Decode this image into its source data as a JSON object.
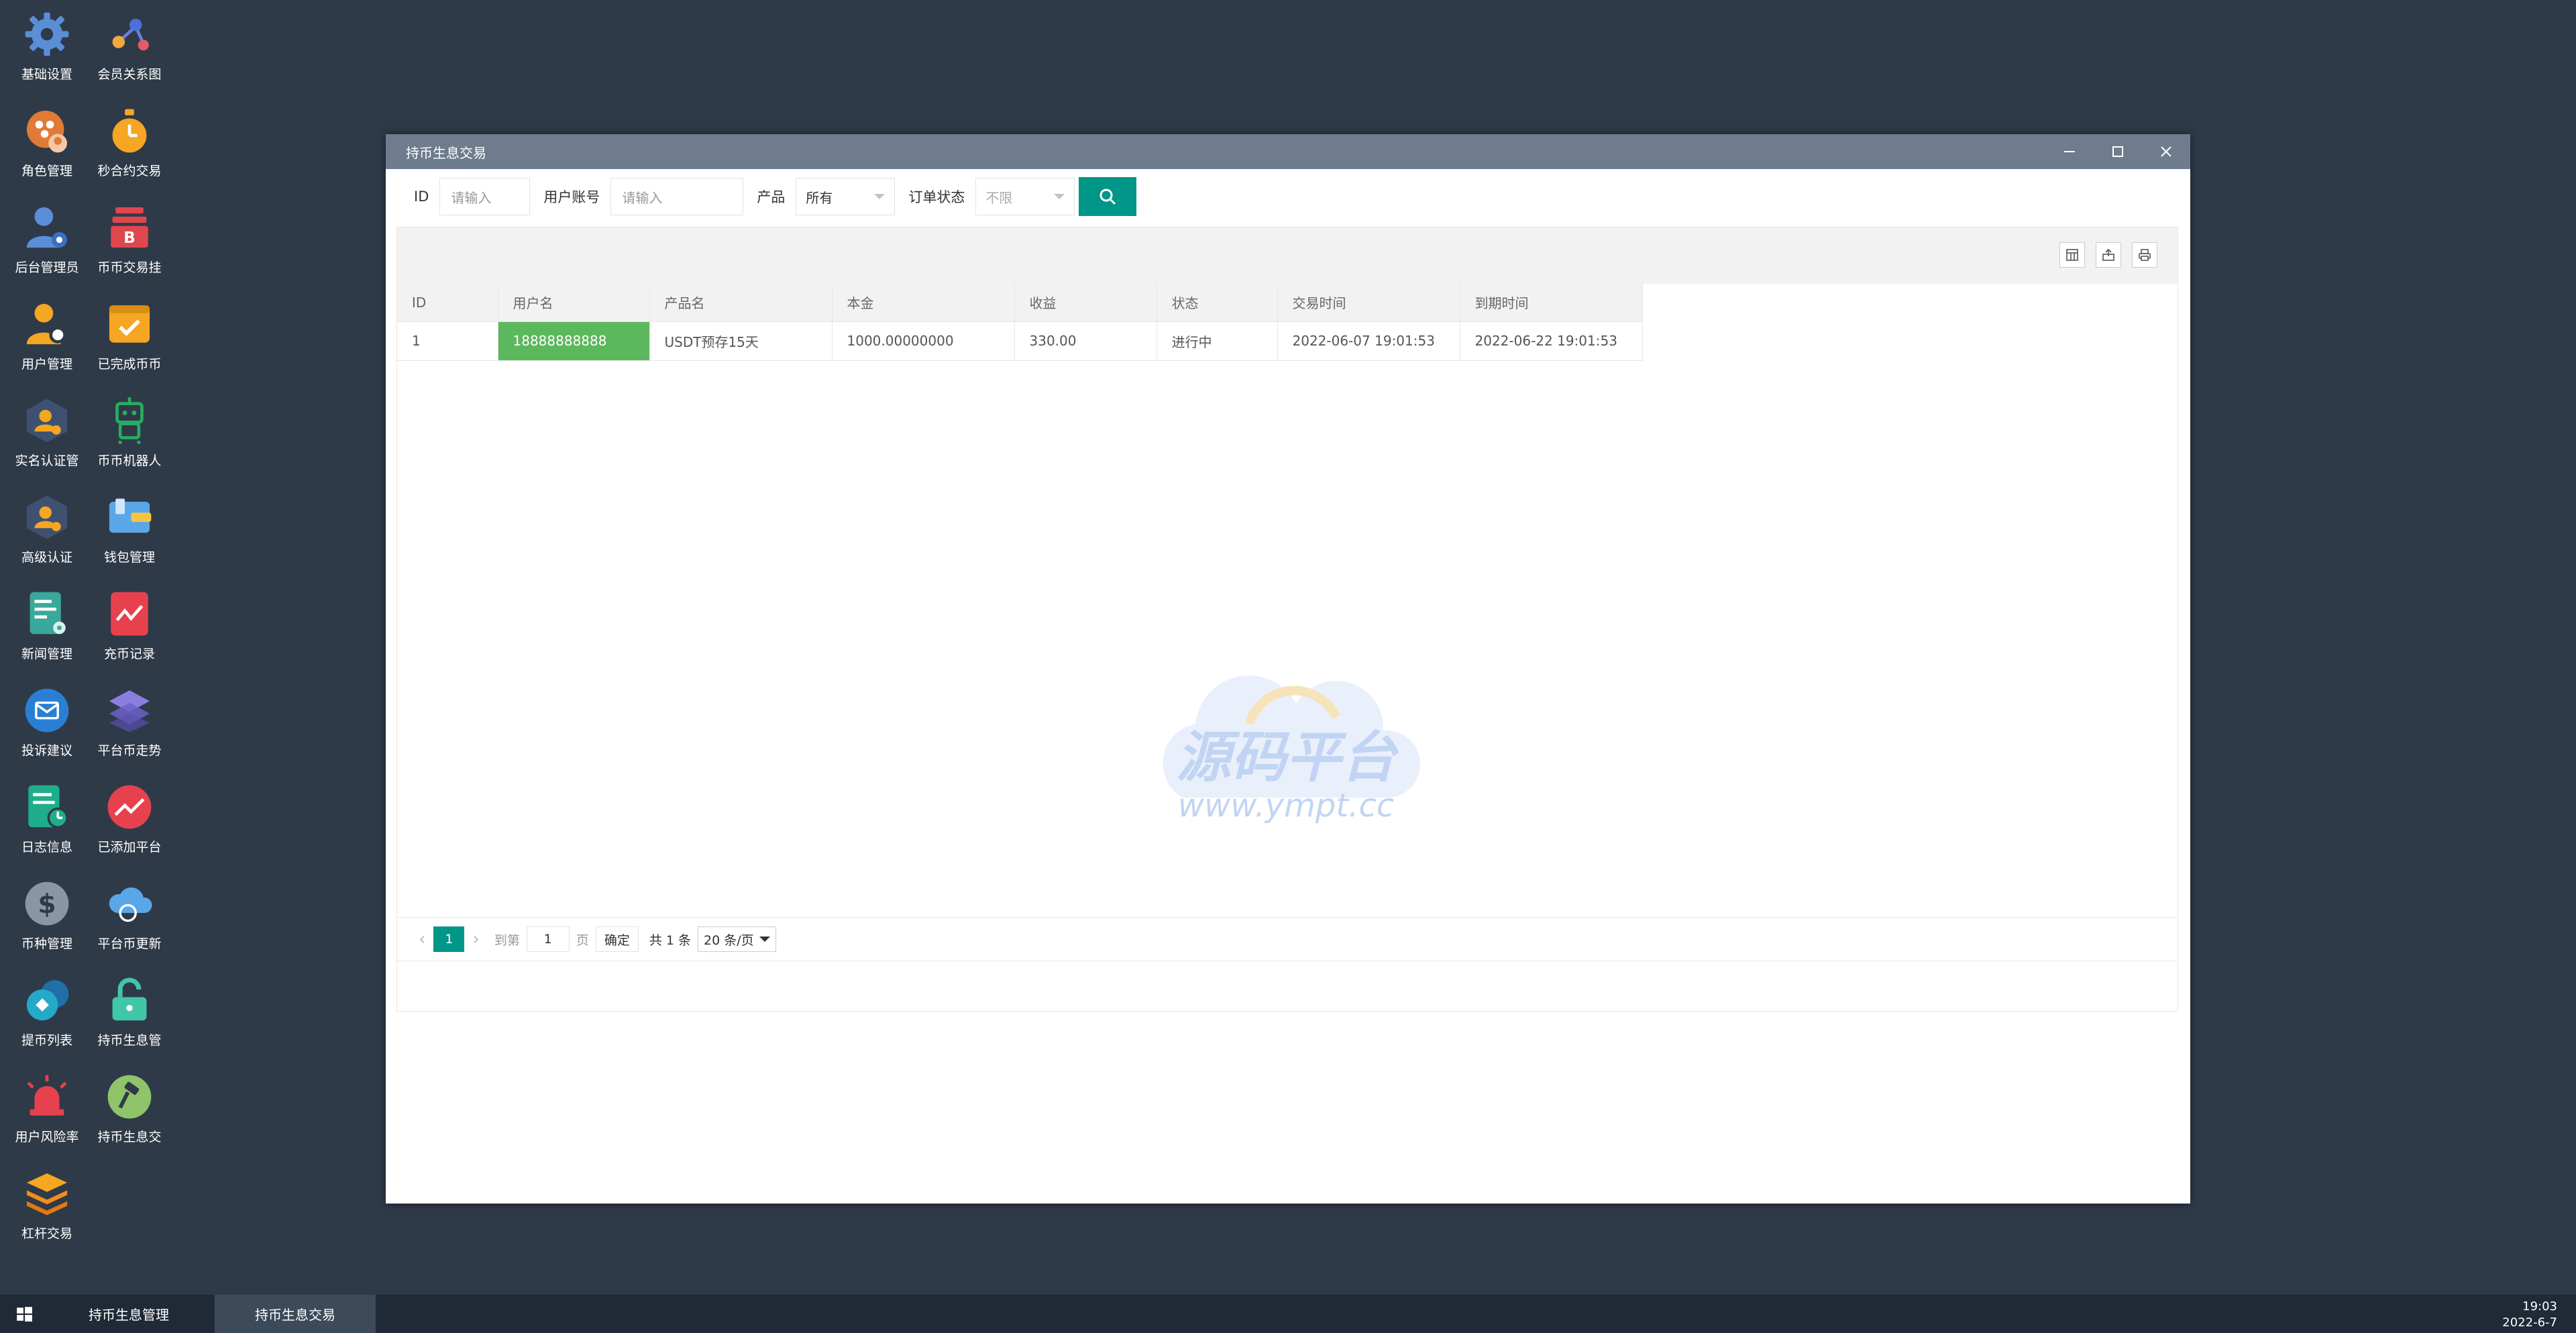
{
  "desktop": {
    "icons": [
      {
        "label": "基础设置",
        "icon": "gear-icon"
      },
      {
        "label": "会员关系图",
        "icon": "network-icon"
      },
      {
        "label": "角色管理",
        "icon": "role-icon"
      },
      {
        "label": "秒合约交易",
        "icon": "stopwatch-icon"
      },
      {
        "label": "后台管理员",
        "icon": "admin-user-icon"
      },
      {
        "label": "币币交易挂",
        "icon": "bitcoin-stack-icon"
      },
      {
        "label": "用户管理",
        "icon": "user-search-icon"
      },
      {
        "label": "已完成币币",
        "icon": "check-box-icon"
      },
      {
        "label": "实名认证管",
        "icon": "verified-user-icon"
      },
      {
        "label": "币币机器人",
        "icon": "robot-icon"
      },
      {
        "label": "高级认证",
        "icon": "advanced-verify-icon"
      },
      {
        "label": "钱包管理",
        "icon": "wallet-icon"
      },
      {
        "label": "新闻管理",
        "icon": "news-doc-icon"
      },
      {
        "label": "充币记录",
        "icon": "chart-card-icon"
      },
      {
        "label": "投诉建议",
        "icon": "mail-icon"
      },
      {
        "label": "平台币走势",
        "icon": "layers-icon"
      },
      {
        "label": "日志信息",
        "icon": "log-clock-icon"
      },
      {
        "label": "已添加平台",
        "icon": "trend-icon"
      },
      {
        "label": "币种管理",
        "icon": "dollar-icon"
      },
      {
        "label": "平台币更新",
        "icon": "cloud-refresh-icon"
      },
      {
        "label": "提币列表",
        "icon": "coin-list-icon"
      },
      {
        "label": "持币生息管",
        "icon": "unlock-icon"
      },
      {
        "label": "用户风险率",
        "icon": "alarm-icon"
      },
      {
        "label": "持币生息交",
        "icon": "hammer-icon"
      },
      {
        "label": "杠杆交易",
        "icon": "stack-icon"
      }
    ]
  },
  "window": {
    "title": "持币生息交易",
    "filters": {
      "id_label": "ID",
      "id_placeholder": "请输入",
      "account_label": "用户账号",
      "account_placeholder": "请输入",
      "product_label": "产品",
      "product_value": "所有",
      "status_label": "订单状态",
      "status_value": "不限"
    },
    "table": {
      "columns": [
        "ID",
        "用户名",
        "产品名",
        "本金",
        "收益",
        "状态",
        "交易时间",
        "到期时间"
      ],
      "rows": [
        [
          "1",
          "18888888888",
          "USDT预存15天",
          "1000.00000000",
          "330.00",
          "进行中",
          "2022-06-07 19:01:53",
          "2022-06-22 19:01:53"
        ]
      ]
    },
    "watermark": {
      "text": "源码平台",
      "url": "www.ympt.cc"
    },
    "pager": {
      "current": "1",
      "goto_label": "到第",
      "goto_value": "1",
      "page_label": "页",
      "confirm": "确定",
      "total": "共 1 条",
      "page_size": "20 条/页"
    }
  },
  "taskbar": {
    "tasks": [
      "持币生息管理",
      "持币生息交易"
    ],
    "time": "19:03",
    "date": "2022-6-7"
  },
  "colors": {
    "desktop": "#2f3a48",
    "primary": "#009688",
    "highlight": "#5cb85c",
    "titlebar": "#6e7c8d"
  }
}
